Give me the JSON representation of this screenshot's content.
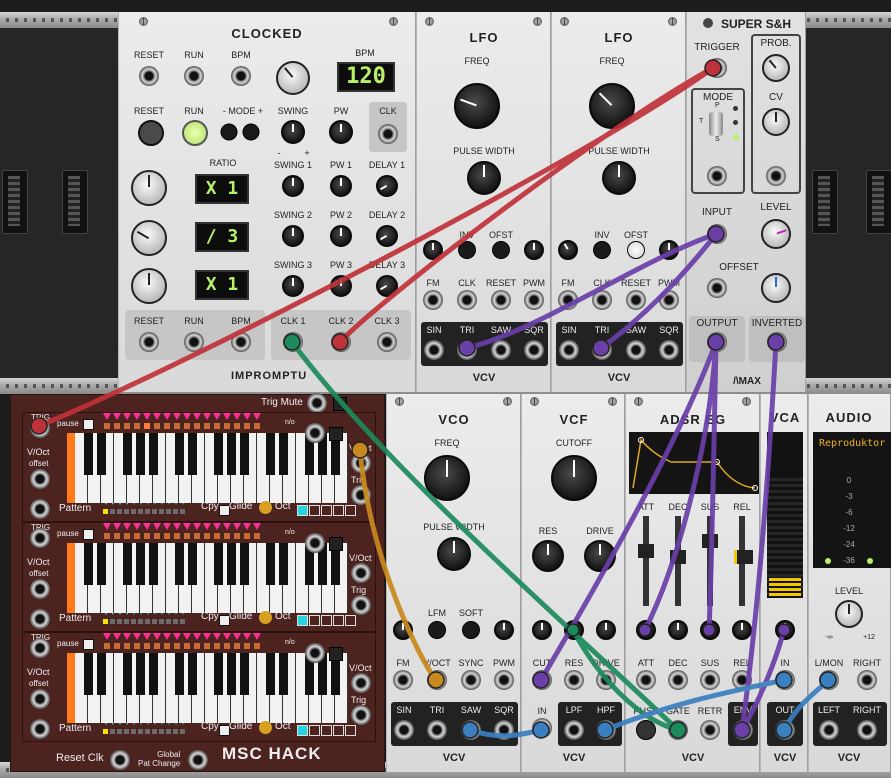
{
  "clocked": {
    "title": "CLOCKED",
    "labels": {
      "reset": "RESET",
      "run": "RUN",
      "bpm": "BPM",
      "bpm_display_label": "BPM",
      "mode": "- MODE +",
      "swing": "SWING",
      "pw": "PW",
      "clk": "CLK",
      "minus": "-",
      "plus": "+",
      "ratio": "RATIO",
      "swing1": "SWING 1",
      "pw1": "PW 1",
      "delay1": "DELAY 1",
      "swing2": "SWING 2",
      "pw2": "PW 2",
      "delay2": "DELAY 2",
      "swing3": "SWING 3",
      "pw3": "PW 3",
      "delay3": "DELAY 3",
      "clk1": "CLK 1",
      "clk2": "CLK 2",
      "clk3": "CLK 3",
      "brand": "IMPROMPTU"
    },
    "bpm_value": "120",
    "ratios": [
      "X 1",
      "/ 3",
      "X 1"
    ]
  },
  "lfo1": {
    "title": "LFO",
    "freq": "FREQ",
    "pulse_width": "PULSE WIDTH",
    "inv": "INV",
    "ofst": "OFST",
    "fm": "FM",
    "clk": "CLK",
    "reset": "RESET",
    "pwm": "PWM",
    "sin": "SIN",
    "tri": "TRI",
    "saw": "SAW",
    "sqr": "SQR",
    "brand": "VCV"
  },
  "lfo2": {
    "title": "LFO",
    "freq": "FREQ",
    "pulse_width": "PULSE WIDTH",
    "inv": "INV",
    "ofst": "OFST",
    "fm": "FM",
    "clk": "CLK",
    "reset": "RESET",
    "pwm": "PWM",
    "sin": "SIN",
    "tri": "TRI",
    "saw": "SAW",
    "sqr": "SQR",
    "brand": "VCV"
  },
  "superSH": {
    "title": "SUPER S&H",
    "trigger": "TRIGGER",
    "prob": "PROB.",
    "cv": "CV",
    "mode": "MODE",
    "p": "P",
    "t": "T",
    "s": "S",
    "input": "INPUT",
    "level": "LEVEL",
    "offset": "OFFSET",
    "output": "OUTPUT",
    "inverted": "INVERTED",
    "brand": "/\\MAX"
  },
  "hack": {
    "trig_mute": "Trig Mute",
    "trig": "TRIG",
    "pause": "pause",
    "voct": "V/Oct",
    "offset": "offset",
    "pattern": "Pattern",
    "cpy": "Cpy",
    "glide": "Glide",
    "oct": "Oct",
    "nv": "n/o",
    "trig_out": "Trig",
    "reset_clk": "Reset Clk",
    "global_pat_change": "Global\nPat Change",
    "brand": "MSC HACK"
  },
  "vco": {
    "title": "VCO",
    "freq": "FREQ",
    "pulse_width": "PULSE WIDTH",
    "lfm": "LFM",
    "soft": "SOFT",
    "fm": "FM",
    "voct": "V/OCT",
    "sync": "SYNC",
    "pwm": "PWM",
    "sin": "SIN",
    "tri": "TRI",
    "saw": "SAW",
    "sqr": "SQR",
    "brand": "VCV"
  },
  "vcf": {
    "title": "VCF",
    "cutoff": "CUTOFF",
    "res": "RES",
    "drive": "DRIVE",
    "cut": "CUT",
    "res_in": "RES",
    "drive_in": "DRIVE",
    "in": "IN",
    "lpf": "LPF",
    "hpf": "HPF",
    "brand": "VCV"
  },
  "adsr": {
    "title": "ADSR EG",
    "att": "ATT",
    "dec": "DEC",
    "sus": "SUS",
    "rel": "REL",
    "push": "PUSH",
    "gate": "GATE",
    "retr": "RETR",
    "env": "ENV",
    "brand": "VCV"
  },
  "vca": {
    "title": "VCA",
    "in": "IN",
    "out": "OUT",
    "brand": "VCV"
  },
  "audio": {
    "title": "AUDIO",
    "device": "Reproduktor",
    "db": [
      "0",
      "-3",
      "-6",
      "-12",
      "-24",
      "-36"
    ],
    "level": "LEVEL",
    "min": "-∞",
    "max": "+12",
    "lmon": "L/MON",
    "right": "RIGHT",
    "left": "LEFT",
    "right_out": "RIGHT",
    "brand": "VCV"
  },
  "colors": {
    "red": "#c0323a",
    "green": "#1d8a5c",
    "purple": "#6a3fa8",
    "orange": "#c88a1e",
    "blue": "#3a7fc0"
  }
}
